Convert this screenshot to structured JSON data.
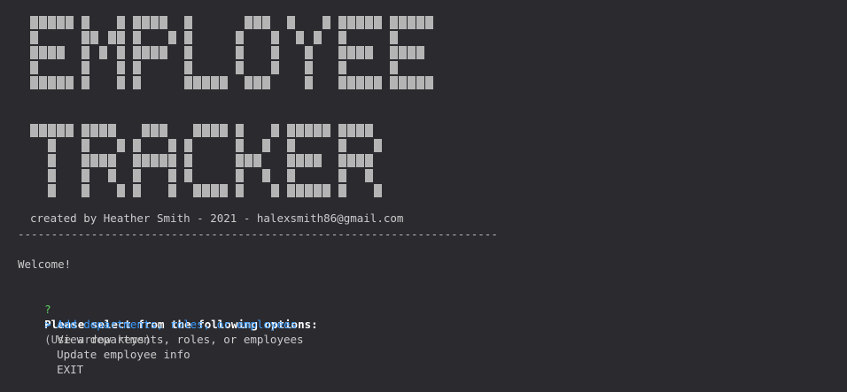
{
  "banner": {
    "lines": [
      "EMPLOYEE",
      "TRACKER"
    ],
    "color": "#b4b4b4"
  },
  "credit": "created by Heather Smith - 2021 - halexsmith86@gmail.com",
  "divider": "------------------------------------------------------------------------",
  "welcome": "Welcome!",
  "prompt": {
    "marker": "?",
    "message": "Please select from the following options:",
    "hint": "(Use arrow keys)"
  },
  "pointer": ">",
  "options": [
    {
      "label": "Add departments, roles, or employees",
      "selected": true
    },
    {
      "label": "View departments, roles, or employees",
      "selected": false
    },
    {
      "label": "Update employee info",
      "selected": false
    },
    {
      "label": "EXIT",
      "selected": false
    }
  ],
  "colors": {
    "background": "#2a2a2f",
    "selected": "#3b9cff",
    "question_mark": "#5fd35f"
  }
}
